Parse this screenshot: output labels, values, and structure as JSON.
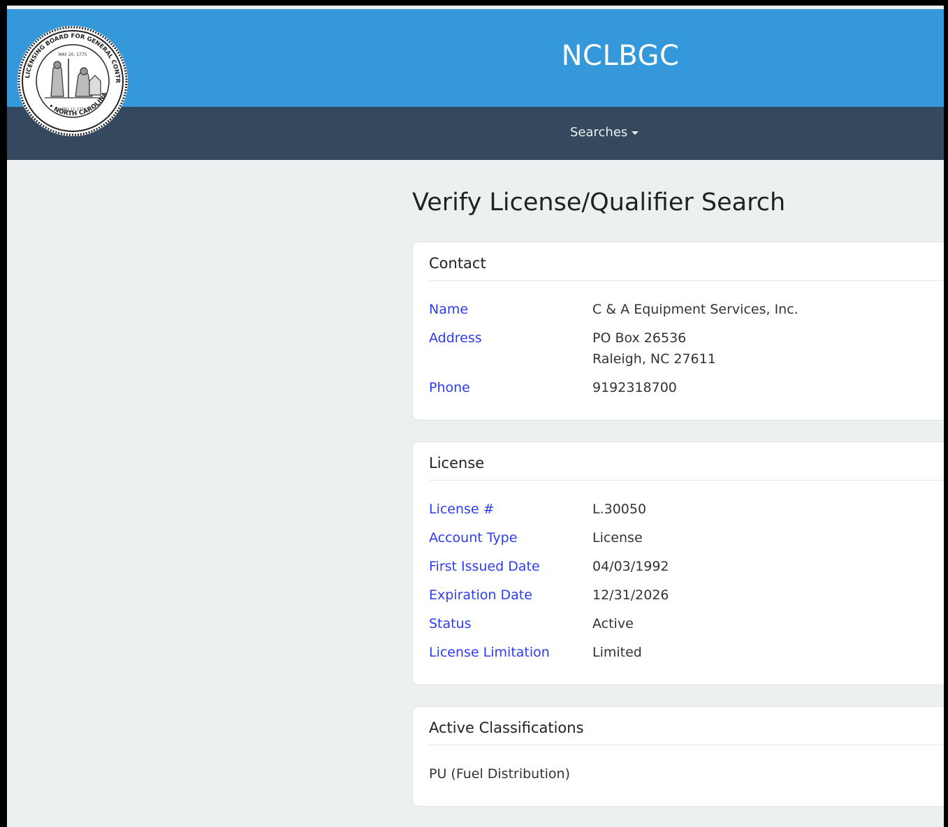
{
  "header": {
    "site_title": "NCLBGC",
    "seal_outer_text": "LICENSING BOARD FOR GENERAL CONTRACTORS",
    "seal_bottom_text": "NORTH CAROLINA"
  },
  "nav": {
    "searches_label": "Searches"
  },
  "page": {
    "heading": "Verify License/Qualifier Search"
  },
  "contact": {
    "title": "Contact",
    "name_label": "Name",
    "name_value": "C & A Equipment Services, Inc.",
    "address_label": "Address",
    "address_line1": "PO Box 26536",
    "address_line2": "Raleigh, NC 27611",
    "phone_label": "Phone",
    "phone_value": "9192318700"
  },
  "license": {
    "title": "License",
    "license_no_label": "License #",
    "license_no_value": "L.30050",
    "account_type_label": "Account Type",
    "account_type_value": "License",
    "first_issued_label": "First Issued Date",
    "first_issued_value": "04/03/1992",
    "expiration_label": "Expiration Date",
    "expiration_value": "12/31/2026",
    "status_label": "Status",
    "status_value": "Active",
    "limitation_label": "License Limitation",
    "limitation_value": "Limited"
  },
  "classifications": {
    "title": "Active Classifications",
    "items": [
      "PU (Fuel Distribution)"
    ]
  },
  "colors": {
    "topbar": "#3498db",
    "navbar": "#34495e",
    "background": "#ecf0f1",
    "label_blue": "#2e3cf0"
  }
}
